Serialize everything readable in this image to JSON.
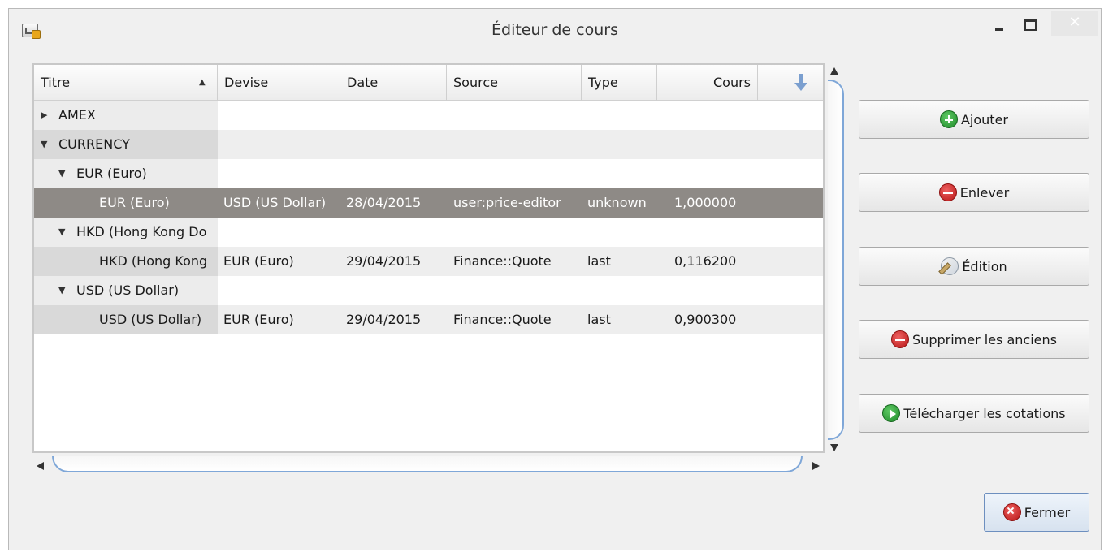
{
  "window": {
    "title": "Éditeur de cours",
    "close_glyph": "✕"
  },
  "table": {
    "columns": [
      "Titre",
      "Devise",
      "Date",
      "Source",
      "Type",
      "Cours"
    ],
    "sort_indicator": "▲",
    "rows": [
      {
        "level": 0,
        "arrow": "▶",
        "titre": "AMEX",
        "devise": "",
        "date": "",
        "source": "",
        "type": "",
        "cours": ""
      },
      {
        "level": 0,
        "arrow": "▼",
        "titre": "CURRENCY",
        "devise": "",
        "date": "",
        "source": "",
        "type": "",
        "cours": ""
      },
      {
        "level": 1,
        "arrow": "▼",
        "titre": "EUR (Euro)",
        "devise": "",
        "date": "",
        "source": "",
        "type": "",
        "cours": ""
      },
      {
        "level": 2,
        "arrow": "",
        "titre": "EUR (Euro)",
        "devise": "USD (US Dollar)",
        "date": "28/04/2015",
        "source": "user:price-editor",
        "type": "unknown",
        "cours": "1,000000"
      },
      {
        "level": 1,
        "arrow": "▼",
        "titre": "HKD (Hong Kong Do",
        "devise": "",
        "date": "",
        "source": "",
        "type": "",
        "cours": ""
      },
      {
        "level": 2,
        "arrow": "",
        "titre": "HKD (Hong Kong",
        "devise": "EUR (Euro)",
        "date": "29/04/2015",
        "source": "Finance::Quote",
        "type": "last",
        "cours": "0,116200"
      },
      {
        "level": 1,
        "arrow": "▼",
        "titre": "USD (US Dollar)",
        "devise": "",
        "date": "",
        "source": "",
        "type": "",
        "cours": ""
      },
      {
        "level": 2,
        "arrow": "",
        "titre": "USD (US Dollar)",
        "devise": "EUR (Euro)",
        "date": "29/04/2015",
        "source": "Finance::Quote",
        "type": "last",
        "cours": "0,900300"
      }
    ],
    "selected_row": 3
  },
  "buttons": {
    "ajouter": "Ajouter",
    "enlever": "Enlever",
    "edition": "Édition",
    "supprimer": "Supprimer les anciens",
    "telecharger": "Télécharger les cotations",
    "fermer": "Fermer"
  },
  "icons": {
    "ajouter": "add-icon",
    "enlever": "remove-icon",
    "edition": "edit-icon",
    "supprimer": "remove-icon",
    "telecharger": "play-icon",
    "fermer": "close-icon",
    "column_menu": "arrow-down-icon"
  },
  "colors": {
    "selected_row_bg": "#8e8a86",
    "scrollbar_accent": "#7fa7d8",
    "close_button_bg": "#e7e7e7"
  }
}
